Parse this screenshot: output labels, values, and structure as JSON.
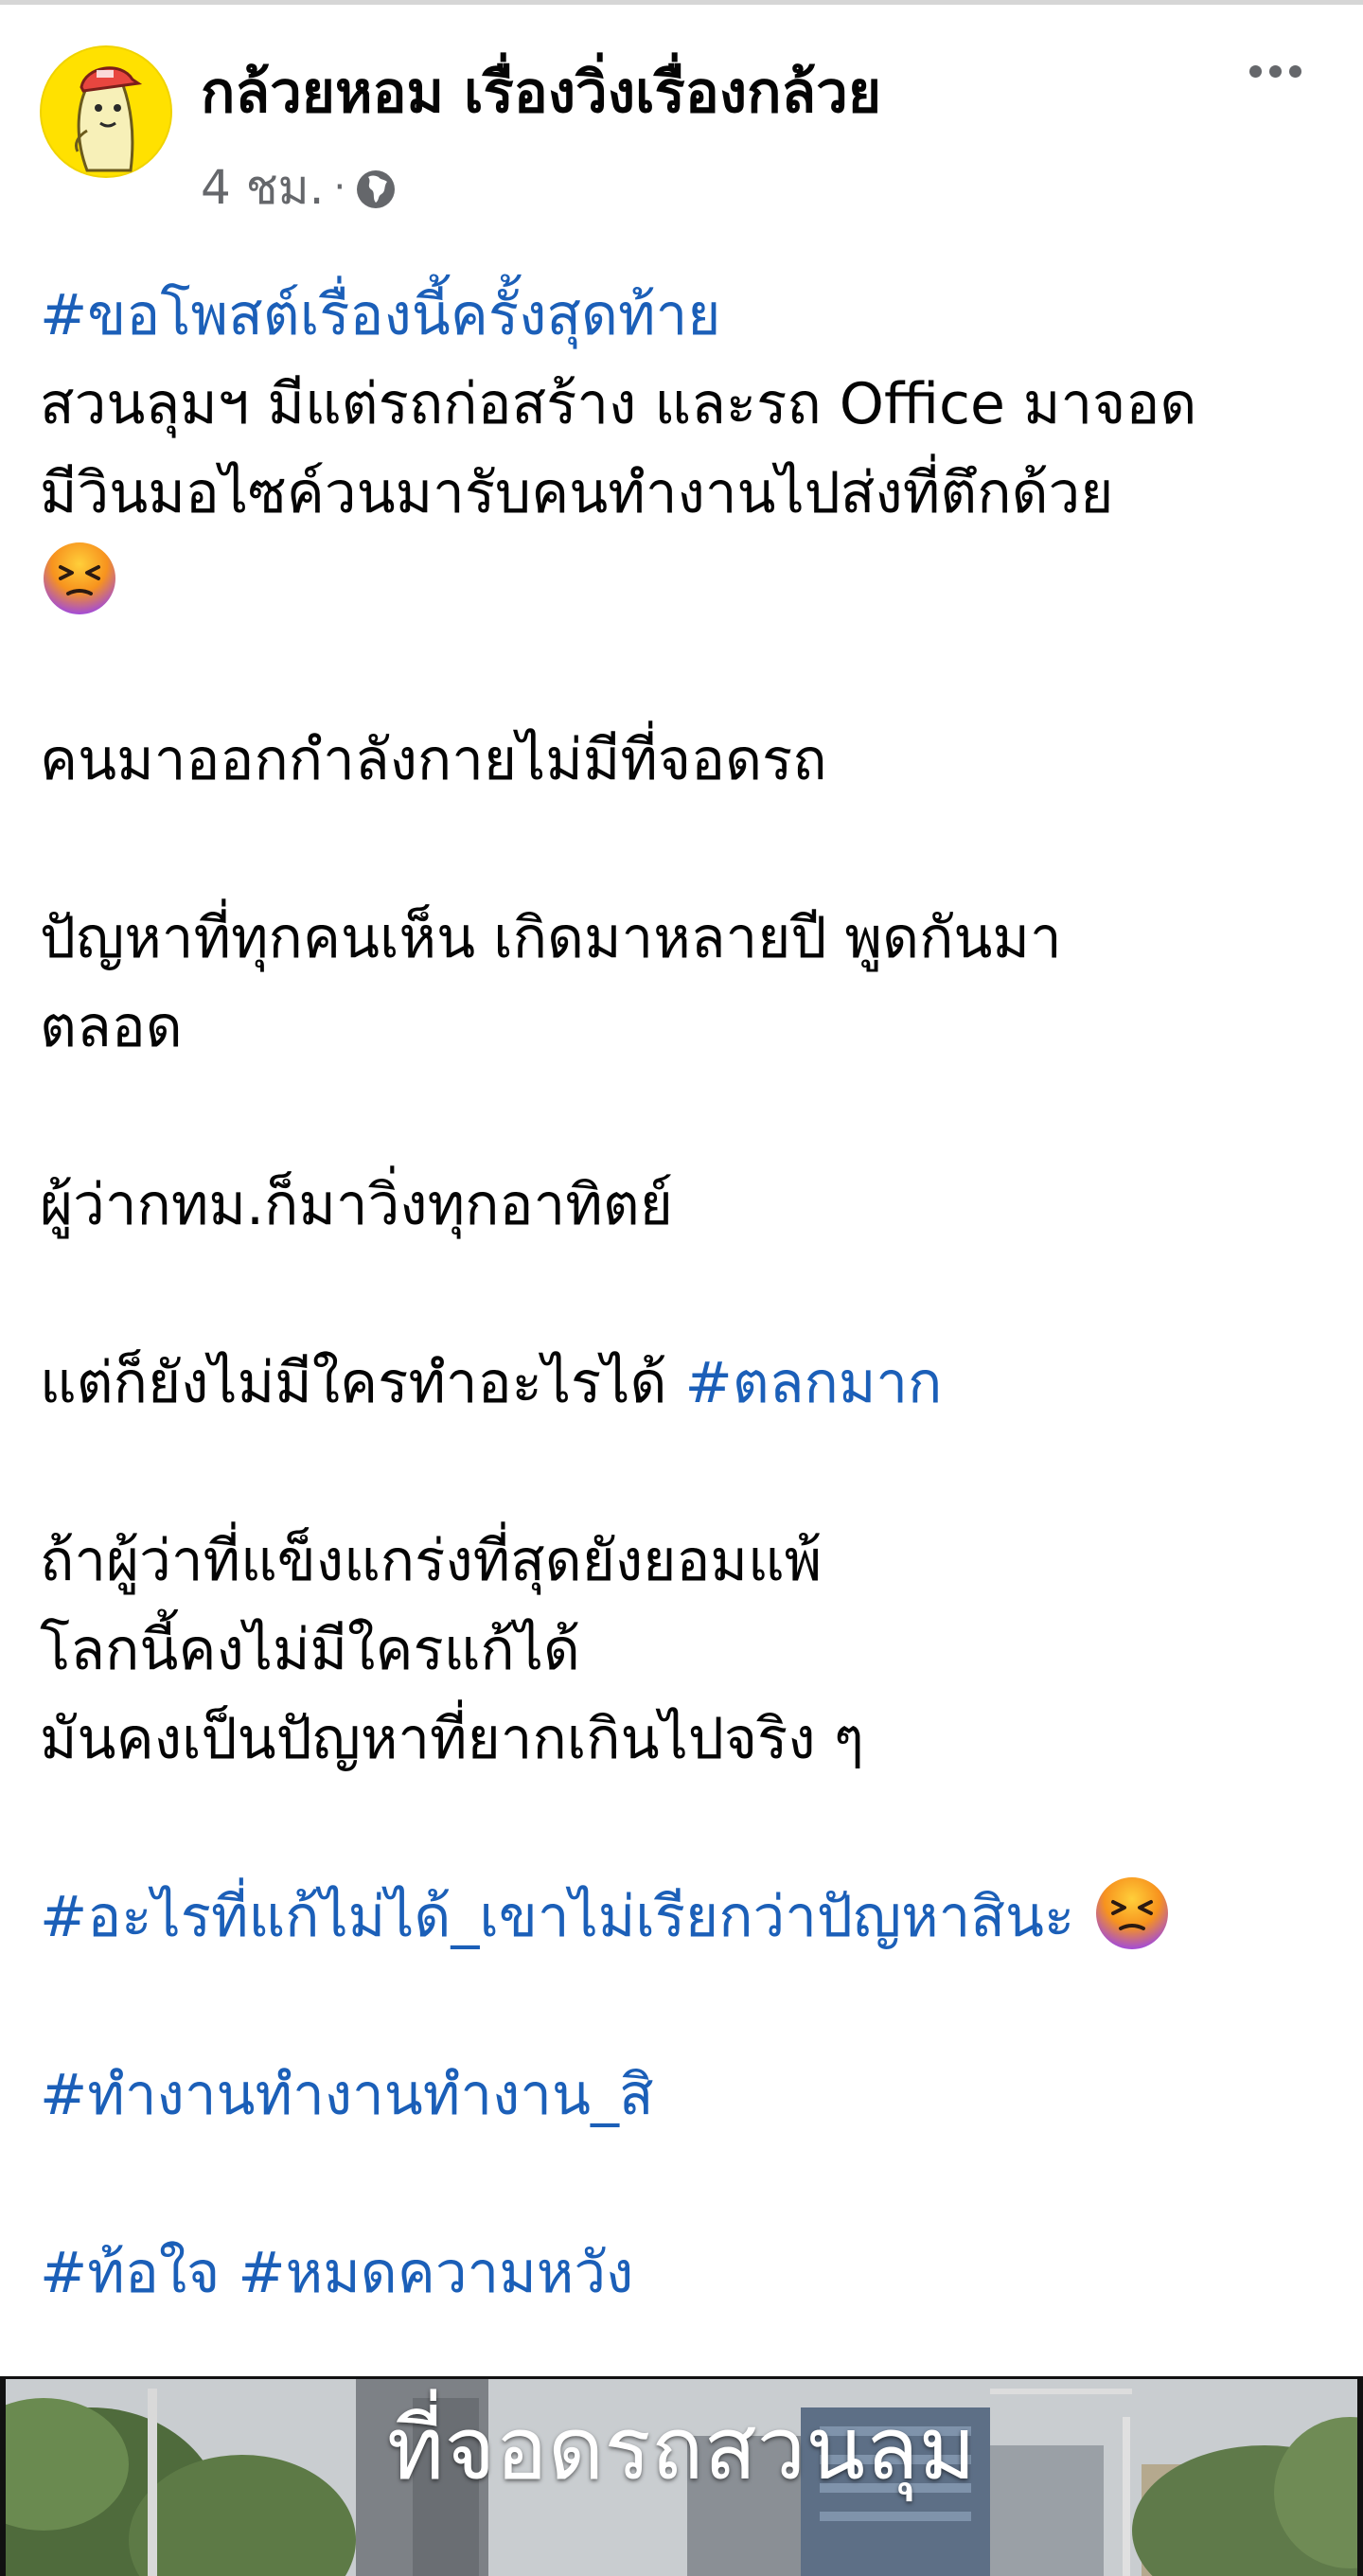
{
  "post": {
    "author": "กล้วยหอม เรื่องวิ่งเรื่องกล้วย",
    "time": "4 ชม.",
    "separator": "·",
    "privacy_icon": "globe-icon",
    "more_icon": "more-options-icon"
  },
  "body": {
    "line1_hashtag": "#ขอโพสต์เรื่องนี้ครั้งสุดท้าย",
    "line2": "สวนลุมฯ มีแต่รถก่อสร้าง และรถ Office มาจอด",
    "line3": "มีวินมอไซค์วนมารับคนทำงานไปส่งที่ตึกด้วย",
    "line5": "คนมาออกกำลังกายไม่มีที่จอดรถ",
    "line7": "ปัญหาที่ทุกคนเห็น เกิดมาหลายปี พูดกันมา",
    "line8": "ตลอด",
    "line10": "ผู้ว่ากทม.ก็มาวิ่งทุกอาทิตย์",
    "line12_text": "แต่ก็ยังไม่มีใครทำอะไรได้ ",
    "line12_hashtag": "#ตลกมาก",
    "line14": "ถ้าผู้ว่าที่แข็งแกร่งที่สุดยังยอมแพ้",
    "line15": "โลกนี้คงไม่มีใครแก้ได้",
    "line16": "มันคงเป็นปัญหาที่ยากเกินไปจริง ๆ",
    "line18_hashtag": "#อะไรที่แก้ไม่ได้_เขาไม่เรียกว่าปัญหาสินะ",
    "line20_hashtag": "#ทำงานทำงานทำงาน_สิ",
    "line22_hashtag1": "#ท้อใจ",
    "line22_hashtag2": "#หมดความหวัง",
    "emoji": "tired-face-emoji"
  },
  "photo": {
    "caption": "ที่จอดรถสวนลุม"
  },
  "colors": {
    "hashtag": "#1b5fb8",
    "meta": "#65676b",
    "avatar_bg": "#ffe100"
  }
}
